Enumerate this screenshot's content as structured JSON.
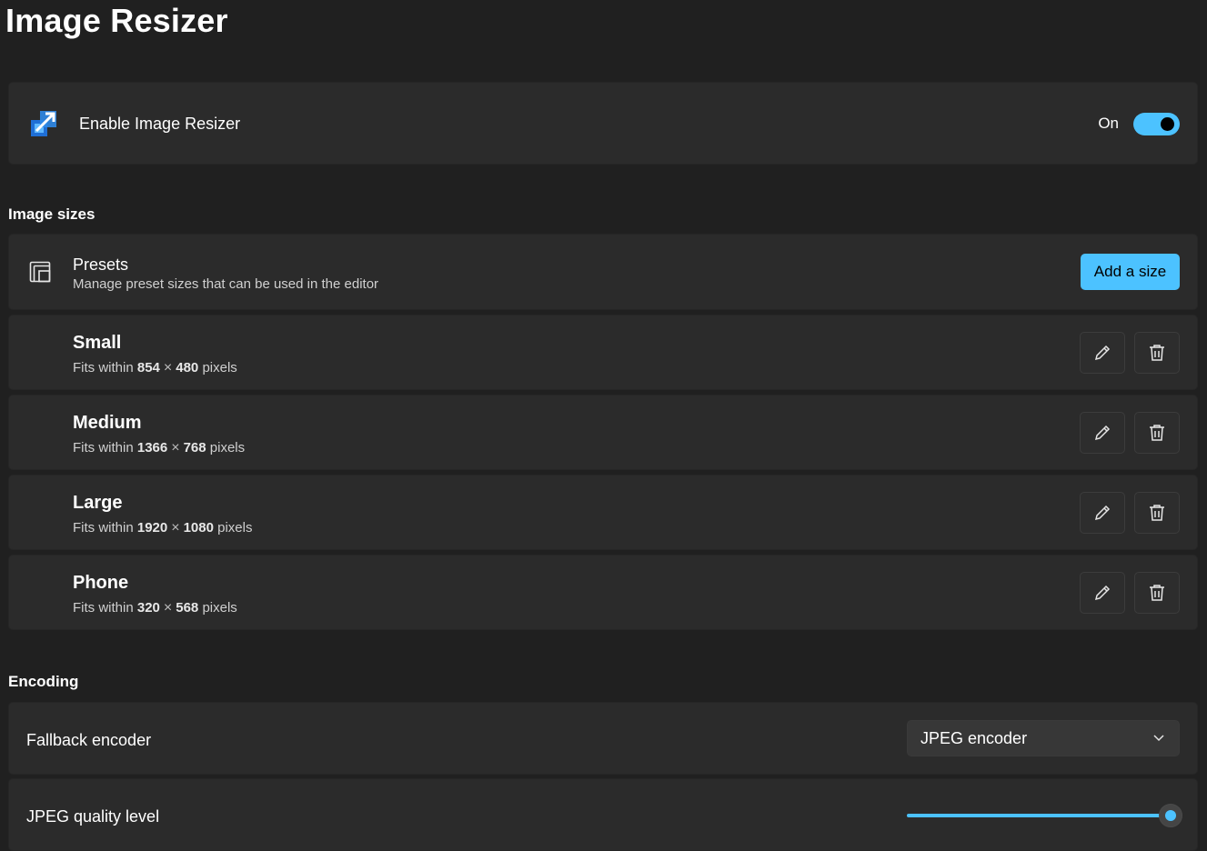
{
  "page": {
    "title": "Image Resizer"
  },
  "enable": {
    "label": "Enable Image Resizer",
    "state_label": "On",
    "enabled": true
  },
  "sections": {
    "image_sizes": "Image sizes",
    "encoding": "Encoding"
  },
  "presets": {
    "title": "Presets",
    "description": "Manage preset sizes that can be used in the editor",
    "add_button": "Add a size"
  },
  "sizes": [
    {
      "name": "Small",
      "prefix": "Fits within",
      "width": "854",
      "height": "480",
      "unit": "pixels"
    },
    {
      "name": "Medium",
      "prefix": "Fits within",
      "width": "1366",
      "height": "768",
      "unit": "pixels"
    },
    {
      "name": "Large",
      "prefix": "Fits within",
      "width": "1920",
      "height": "1080",
      "unit": "pixels"
    },
    {
      "name": "Phone",
      "prefix": "Fits within",
      "width": "320",
      "height": "568",
      "unit": "pixels"
    }
  ],
  "encoding": {
    "fallback_label": "Fallback encoder",
    "fallback_value": "JPEG encoder",
    "quality_label": "JPEG quality level",
    "quality_fraction": 1.0
  },
  "icons": {
    "app": "image-resizer-icon",
    "presets": "presets-icon",
    "edit": "pencil-icon",
    "delete": "trash-icon",
    "dropdown": "chevron-down-icon"
  },
  "colors": {
    "accent": "#4cc2ff",
    "background": "#202020",
    "card": "#2b2b2b"
  }
}
